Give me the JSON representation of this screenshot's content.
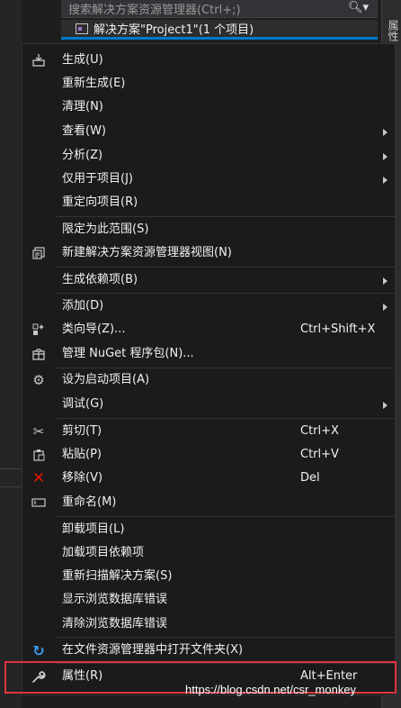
{
  "solution_explorer": {
    "search_placeholder": "搜索解决方案资源管理器(Ctrl+;)",
    "root_label": "解决方案\"Project1\"(1 个项目)"
  },
  "side_tab": {
    "label": "属性"
  },
  "menu": {
    "items": [
      {
        "label": "生成(U)",
        "icon": "build-icon"
      },
      {
        "label": "重新生成(E)"
      },
      {
        "label": "清理(N)"
      },
      {
        "label": "查看(W)",
        "submenu": true
      },
      {
        "label": "分析(Z)",
        "submenu": true
      },
      {
        "label": "仅用于项目(J)",
        "submenu": true
      },
      {
        "label": "重定向项目(R)"
      },
      {
        "label": "限定为此范围(S)"
      },
      {
        "label": "新建解决方案资源管理器视图(N)",
        "icon": "new-view-icon"
      },
      {
        "label": "生成依赖项(B)",
        "submenu": true
      },
      {
        "label": "添加(D)",
        "submenu": true
      },
      {
        "label": "类向导(Z)...",
        "shortcut": "Ctrl+Shift+X",
        "icon": "class-wizard-icon"
      },
      {
        "label": "管理 NuGet 程序包(N)...",
        "icon": "nuget-icon"
      },
      {
        "label": "设为启动项目(A)",
        "icon": "gear-icon"
      },
      {
        "label": "调试(G)",
        "submenu": true
      },
      {
        "label": "剪切(T)",
        "shortcut": "Ctrl+X",
        "icon": "scissors-icon"
      },
      {
        "label": "粘贴(P)",
        "shortcut": "Ctrl+V",
        "icon": "paste-icon"
      },
      {
        "label": "移除(V)",
        "shortcut": "Del",
        "icon": "remove-icon"
      },
      {
        "label": "重命名(M)",
        "icon": "rename-icon"
      },
      {
        "label": "卸载项目(L)"
      },
      {
        "label": "加载项目依赖项"
      },
      {
        "label": "重新扫描解决方案(S)"
      },
      {
        "label": "显示浏览数据库错误"
      },
      {
        "label": "清除浏览数据库错误"
      },
      {
        "label": "在文件资源管理器中打开文件夹(X)",
        "icon": "open-folder-icon"
      },
      {
        "label": "属性(R)",
        "shortcut": "Alt+Enter",
        "icon": "wrench-icon"
      }
    ]
  },
  "watermark": "https://blog.csdn.net/csr_monkey",
  "colors": {
    "accent": "#007acc",
    "highlight_border": "#e0353b",
    "remove_red": "#e51400"
  }
}
